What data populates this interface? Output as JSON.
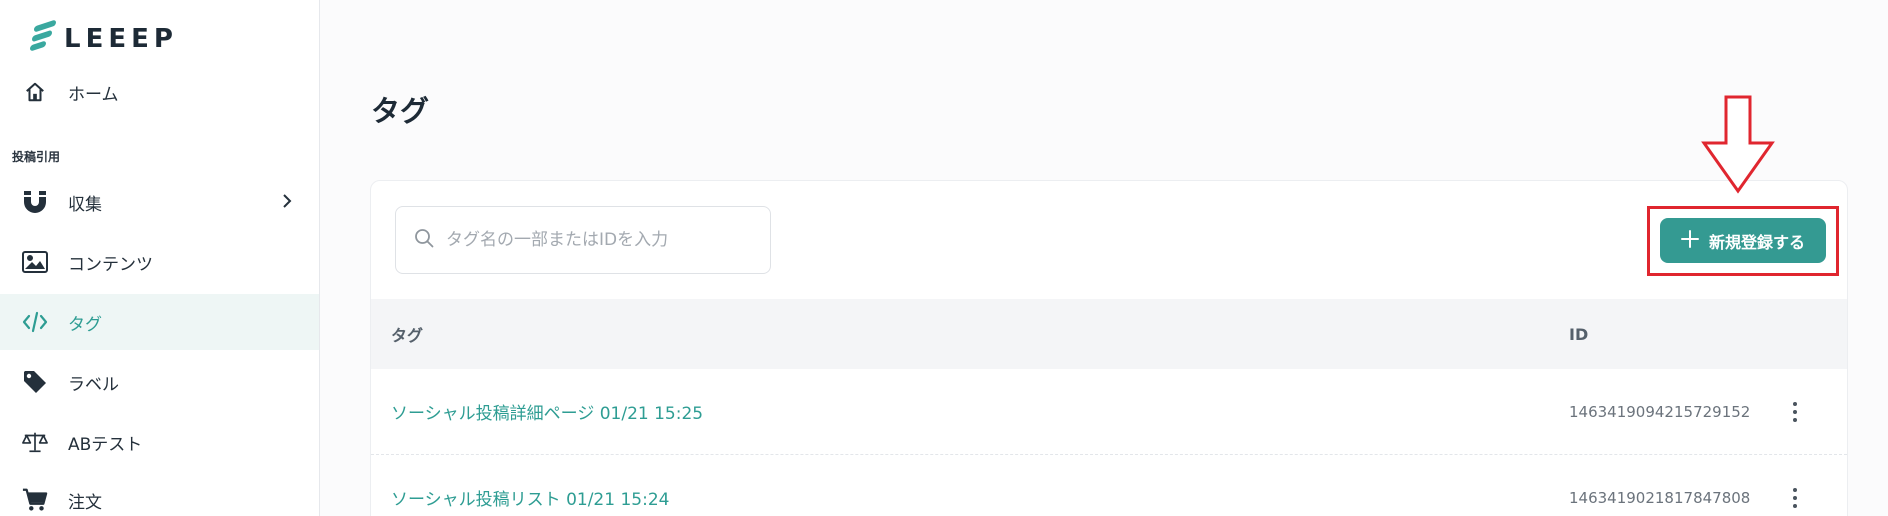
{
  "brand": {
    "name": "LEEEP"
  },
  "sidebar": {
    "section_label": "投稿引用",
    "items": [
      {
        "label": "ホーム",
        "icon": "home-icon"
      },
      {
        "label": "収集",
        "icon": "magnet-icon"
      },
      {
        "label": "コンテンツ",
        "icon": "image-icon"
      },
      {
        "label": "タグ",
        "icon": "code-icon",
        "active": true
      },
      {
        "label": "ラベル",
        "icon": "price-tag-icon"
      },
      {
        "label": "ABテスト",
        "icon": "scale-icon"
      },
      {
        "label": "注文",
        "icon": "cart-icon"
      }
    ]
  },
  "page": {
    "title": "タグ"
  },
  "search": {
    "placeholder": "タグ名の一部またはIDを入力"
  },
  "toolbar": {
    "add_label": "新規登録する"
  },
  "table": {
    "headers": {
      "tag": "タグ",
      "id": "ID"
    },
    "rows": [
      {
        "name": "ソーシャル投稿詳細ページ 01/21 15:25",
        "id": "1463419094215729152"
      },
      {
        "name": "ソーシャル投稿リスト 01/21 15:24",
        "id": "1463419021817847808"
      }
    ]
  },
  "colors": {
    "accent": "#349a92",
    "annotation": "#e0262f"
  }
}
